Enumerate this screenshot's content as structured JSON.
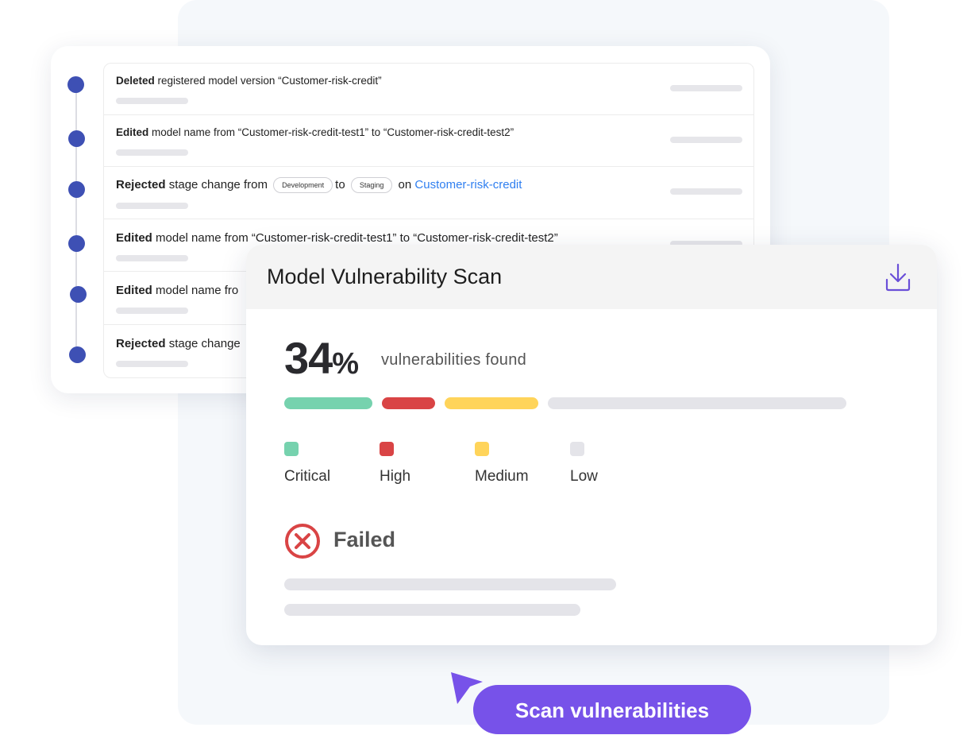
{
  "activity": {
    "items": [
      {
        "action": "Deleted",
        "text": " registered model version “Customer-risk-credit”"
      },
      {
        "action": "Edited",
        "text": " model name from “Customer-risk-credit-test1” to “Customer-risk-credit-test2”"
      },
      {
        "action": "Rejected",
        "text": " stage change from",
        "from_stage": "Development",
        "to_word": "to",
        "to_stage": "Staging",
        "on_word": "on",
        "model_link": "Customer-risk-credit"
      },
      {
        "action": "Edited",
        "text": " model name from “Customer-risk-credit-test1” to “Customer-risk-credit-test2”"
      },
      {
        "action": "Edited",
        "text": " model name fro"
      },
      {
        "action": "Rejected",
        "text": " stage change"
      }
    ]
  },
  "scan": {
    "title": "Model Vulnerability Scan",
    "download_icon": "download-icon",
    "percent_value": "34",
    "percent_sign": "%",
    "found_label": "vulnerabilities found",
    "severity_bar_percent": {
      "critical": 16.6,
      "high": 10,
      "medium": 17.5,
      "low": 56
    },
    "legend": [
      {
        "label": "Critical",
        "color": "#76d2ae"
      },
      {
        "label": "High",
        "color": "#d94445"
      },
      {
        "label": "Medium",
        "color": "#ffd45a"
      },
      {
        "label": "Low",
        "color": "#e4e4e9"
      }
    ],
    "status": "Failed",
    "status_icon": "x-circle-icon",
    "status_color": "#d94445"
  },
  "cta": {
    "label": "Scan vulnerabilities",
    "color": "#7752e9"
  }
}
